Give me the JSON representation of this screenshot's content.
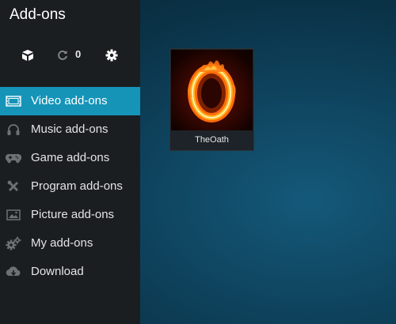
{
  "app": {
    "title": "Add-ons"
  },
  "toolbar": {
    "install_icon": "open-box-icon",
    "update_icon": "refresh-icon",
    "update_count": "0",
    "settings_icon": "gear-icon"
  },
  "sidebar": {
    "items": [
      {
        "label": "Video add-ons",
        "icon": "film-icon",
        "active": true
      },
      {
        "label": "Music add-ons",
        "icon": "headphones-icon",
        "active": false
      },
      {
        "label": "Game add-ons",
        "icon": "gamepad-icon",
        "active": false
      },
      {
        "label": "Program add-ons",
        "icon": "tools-icon",
        "active": false
      },
      {
        "label": "Picture add-ons",
        "icon": "picture-icon",
        "active": false
      },
      {
        "label": "My add-ons",
        "icon": "gears-icon",
        "active": false
      },
      {
        "label": "Download",
        "icon": "cloud-download-icon",
        "active": false
      }
    ]
  },
  "addons": [
    {
      "name": "TheOath",
      "icon": "flaming-o-logo"
    }
  ],
  "colors": {
    "accent": "#1594b8",
    "sidebar": "#1b1e21",
    "background": "#0f4560"
  }
}
